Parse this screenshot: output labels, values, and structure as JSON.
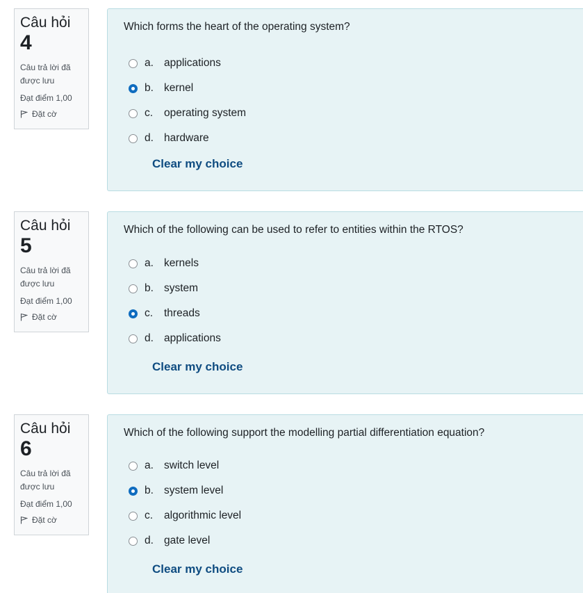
{
  "questions": [
    {
      "label": "Câu hỏi",
      "number": "4",
      "state": "Câu trả lời đã được lưu",
      "grade": "Đạt điểm 1,00",
      "flag": "Đặt cờ",
      "text": "Which forms the heart of the operating system?",
      "options": [
        {
          "letter": "a.",
          "text": "applications",
          "checked": false
        },
        {
          "letter": "b.",
          "text": "kernel",
          "checked": true
        },
        {
          "letter": "c.",
          "text": "operating system",
          "checked": false
        },
        {
          "letter": "d.",
          "text": "hardware",
          "checked": false
        }
      ],
      "clear": "Clear my choice"
    },
    {
      "label": "Câu hỏi",
      "number": "5",
      "state": "Câu trả lời đã được lưu",
      "grade": "Đạt điểm 1,00",
      "flag": "Đặt cờ",
      "text": "Which of the following can be used to refer to entities within the RTOS?",
      "options": [
        {
          "letter": "a.",
          "text": "kernels",
          "checked": false
        },
        {
          "letter": "b.",
          "text": "system",
          "checked": false
        },
        {
          "letter": "c.",
          "text": "threads",
          "checked": true
        },
        {
          "letter": "d.",
          "text": "applications",
          "checked": false
        }
      ],
      "clear": "Clear my choice"
    },
    {
      "label": "Câu hỏi",
      "number": "6",
      "state": "Câu trả lời đã được lưu",
      "grade": "Đạt điểm 1,00",
      "flag": "Đặt cờ",
      "text": "Which of the following support the modelling partial differentiation equation?",
      "options": [
        {
          "letter": "a.",
          "text": "switch level",
          "checked": false
        },
        {
          "letter": "b.",
          "text": "system level",
          "checked": true
        },
        {
          "letter": "c.",
          "text": "algorithmic level",
          "checked": false
        },
        {
          "letter": "d.",
          "text": "gate level",
          "checked": false
        }
      ],
      "clear": "Clear my choice"
    }
  ]
}
